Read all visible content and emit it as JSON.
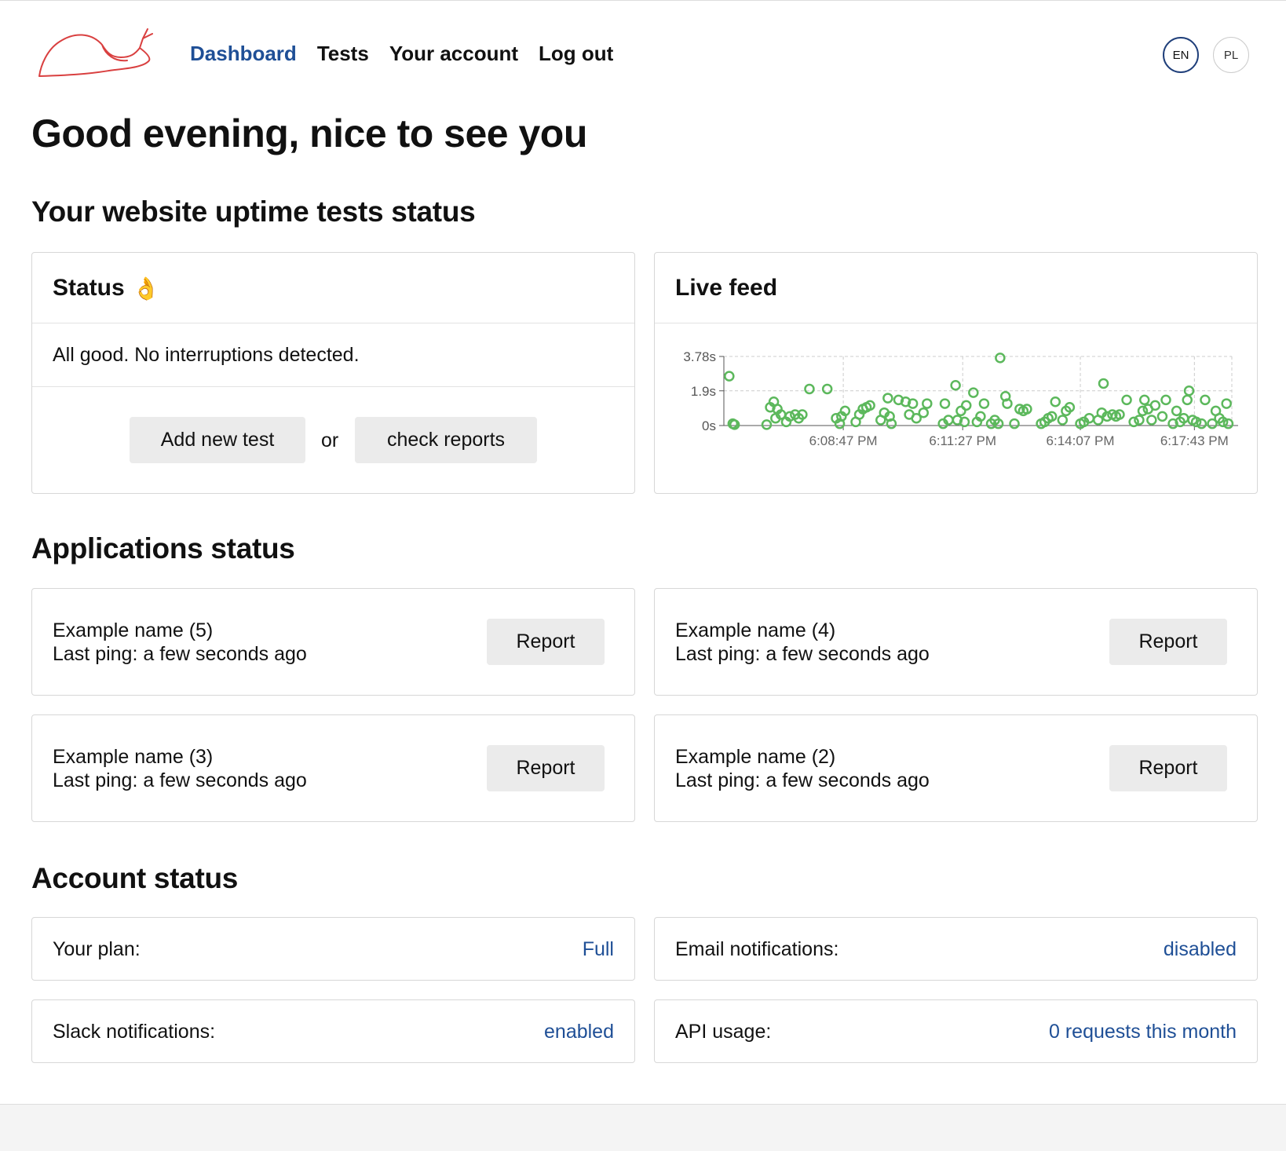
{
  "nav": {
    "items": [
      "Dashboard",
      "Tests",
      "Your account",
      "Log out"
    ],
    "active": "Dashboard"
  },
  "lang": {
    "en": "EN",
    "pl": "PL"
  },
  "greeting": "Good evening, nice to see you",
  "uptime": {
    "heading": "Your website uptime tests status",
    "status": {
      "title": "Status",
      "emoji": "👌",
      "message": "All good. No interruptions detected.",
      "add_button": "Add new test",
      "or": "or",
      "reports_button": "check reports"
    },
    "live": {
      "title": "Live feed"
    }
  },
  "chart_data": {
    "type": "scatter",
    "y_ticks": [
      "0s",
      "1.9s",
      "3.78s"
    ],
    "ylim": [
      0,
      3.78
    ],
    "x_ticks": [
      "6:08:47 PM",
      "6:11:27 PM",
      "6:14:07 PM",
      "6:17:43 PM"
    ],
    "grid": true,
    "point_color": "#5cb85c",
    "series": [
      {
        "values": [
          [
            0.3,
            2.7
          ],
          [
            0.5,
            0.1
          ],
          [
            0.6,
            0.05
          ],
          [
            2.4,
            0.05
          ],
          [
            2.6,
            1.0
          ],
          [
            2.8,
            1.3
          ],
          [
            2.9,
            0.4
          ],
          [
            3.0,
            0.9
          ],
          [
            3.2,
            0.6
          ],
          [
            3.5,
            0.2
          ],
          [
            3.7,
            0.5
          ],
          [
            4.0,
            0.6
          ],
          [
            4.2,
            0.4
          ],
          [
            4.4,
            0.6
          ],
          [
            4.8,
            2.0
          ],
          [
            5.8,
            2.0
          ],
          [
            6.3,
            0.4
          ],
          [
            6.5,
            0.1
          ],
          [
            6.6,
            0.5
          ],
          [
            6.8,
            0.8
          ],
          [
            7.4,
            0.2
          ],
          [
            7.6,
            0.6
          ],
          [
            7.8,
            0.9
          ],
          [
            8.0,
            1.0
          ],
          [
            8.2,
            1.1
          ],
          [
            8.8,
            0.3
          ],
          [
            9.0,
            0.7
          ],
          [
            9.2,
            1.5
          ],
          [
            9.3,
            0.5
          ],
          [
            9.4,
            0.1
          ],
          [
            9.8,
            1.4
          ],
          [
            10.2,
            1.3
          ],
          [
            10.4,
            0.6
          ],
          [
            10.6,
            1.2
          ],
          [
            10.8,
            0.4
          ],
          [
            11.2,
            0.7
          ],
          [
            11.4,
            1.2
          ],
          [
            12.3,
            0.1
          ],
          [
            12.4,
            1.2
          ],
          [
            12.6,
            0.3
          ],
          [
            13.0,
            2.2
          ],
          [
            13.1,
            0.3
          ],
          [
            13.3,
            0.8
          ],
          [
            13.5,
            0.2
          ],
          [
            13.6,
            1.1
          ],
          [
            14.0,
            1.8
          ],
          [
            14.2,
            0.2
          ],
          [
            14.4,
            0.5
          ],
          [
            14.6,
            1.2
          ],
          [
            15.0,
            0.1
          ],
          [
            15.2,
            0.3
          ],
          [
            15.4,
            0.1
          ],
          [
            15.5,
            3.7
          ],
          [
            15.8,
            1.6
          ],
          [
            15.9,
            1.2
          ],
          [
            16.3,
            0.1
          ],
          [
            16.6,
            0.9
          ],
          [
            16.8,
            0.8
          ],
          [
            17.0,
            0.9
          ],
          [
            17.8,
            0.1
          ],
          [
            18.0,
            0.2
          ],
          [
            18.2,
            0.4
          ],
          [
            18.4,
            0.5
          ],
          [
            18.6,
            1.3
          ],
          [
            19.0,
            0.3
          ],
          [
            19.2,
            0.8
          ],
          [
            19.4,
            1.0
          ],
          [
            20.0,
            0.1
          ],
          [
            20.2,
            0.2
          ],
          [
            20.5,
            0.4
          ],
          [
            21.0,
            0.3
          ],
          [
            21.2,
            0.7
          ],
          [
            21.3,
            2.3
          ],
          [
            21.5,
            0.5
          ],
          [
            21.8,
            0.6
          ],
          [
            22.0,
            0.5
          ],
          [
            22.2,
            0.6
          ],
          [
            22.6,
            1.4
          ],
          [
            23.0,
            0.2
          ],
          [
            23.3,
            0.3
          ],
          [
            23.5,
            0.8
          ],
          [
            23.6,
            1.4
          ],
          [
            23.8,
            0.9
          ],
          [
            24.0,
            0.3
          ],
          [
            24.2,
            1.1
          ],
          [
            24.6,
            0.5
          ],
          [
            24.8,
            1.4
          ],
          [
            25.2,
            0.1
          ],
          [
            25.4,
            0.8
          ],
          [
            25.6,
            0.2
          ],
          [
            25.8,
            0.4
          ],
          [
            26.0,
            1.4
          ],
          [
            26.1,
            1.9
          ],
          [
            26.3,
            0.3
          ],
          [
            26.5,
            0.2
          ],
          [
            26.8,
            0.1
          ],
          [
            27.0,
            1.4
          ],
          [
            27.4,
            0.1
          ],
          [
            27.6,
            0.8
          ],
          [
            27.8,
            0.4
          ],
          [
            28.0,
            0.2
          ],
          [
            28.2,
            1.2
          ],
          [
            28.3,
            0.1
          ]
        ]
      }
    ]
  },
  "applications": {
    "heading": "Applications status",
    "items": [
      {
        "name": "Example name (5)",
        "ping": "Last ping: a few seconds ago",
        "button": "Report"
      },
      {
        "name": "Example name (4)",
        "ping": "Last ping: a few seconds ago",
        "button": "Report"
      },
      {
        "name": "Example name (3)",
        "ping": "Last ping: a few seconds ago",
        "button": "Report"
      },
      {
        "name": "Example name (2)",
        "ping": "Last ping: a few seconds ago",
        "button": "Report"
      }
    ]
  },
  "account": {
    "heading": "Account status",
    "items": [
      {
        "label": "Your plan:",
        "value": "Full"
      },
      {
        "label": "Email notifications:",
        "value": "disabled"
      },
      {
        "label": "Slack notifications:",
        "value": "enabled"
      },
      {
        "label": "API usage:",
        "value": "0 requests this month"
      }
    ]
  },
  "colors": {
    "accent": "#1f4f96",
    "logo": "#d94040",
    "chart_point": "#5cb85c"
  }
}
